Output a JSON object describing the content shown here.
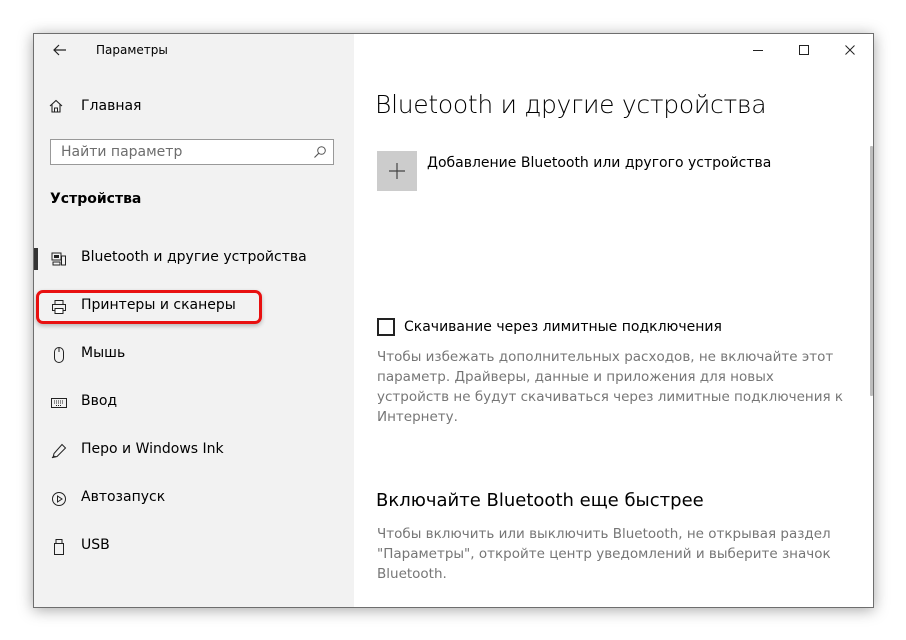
{
  "app": {
    "title": "Параметры"
  },
  "sidebar": {
    "home_label": "Главная",
    "search_placeholder": "Найти параметр",
    "section_title": "Устройства",
    "items": [
      {
        "label": "Bluetooth и другие устройства",
        "icon": "bluetooth-devices-icon",
        "selected": true
      },
      {
        "label": "Принтеры и сканеры",
        "icon": "printer-icon",
        "highlighted": true
      },
      {
        "label": "Мышь",
        "icon": "mouse-icon"
      },
      {
        "label": "Ввод",
        "icon": "keyboard-icon"
      },
      {
        "label": "Перо и Windows Ink",
        "icon": "pen-icon"
      },
      {
        "label": "Автозапуск",
        "icon": "autoplay-icon"
      },
      {
        "label": "USB",
        "icon": "usb-icon"
      }
    ]
  },
  "content": {
    "title": "Bluetooth и другие устройства",
    "add_device_label": "Добавление Bluetooth или другого устройства",
    "metered_checkbox_label": "Скачивание через лимитные подключения",
    "metered_checked": false,
    "metered_description_lines": [
      "Чтобы избежать дополнительных расходов, не включайте этот",
      "параметр. Драйверы, данные и приложения для новых",
      "устройств не будут скачиваться через лимитные подключения к",
      "Интернету."
    ],
    "faster_title": "Включайте Bluetooth еще быстрее",
    "faster_description_lines": [
      "Чтобы включить или выключить Bluetooth, не открывая раздел",
      "\"Параметры\", откройте центр уведомлений и выберите значок",
      "Bluetooth."
    ]
  },
  "colors": {
    "sidebar_bg": "#f2f2f2",
    "highlight": "#e81010",
    "add_tile": "#cccccc",
    "desc_text": "#767676"
  }
}
